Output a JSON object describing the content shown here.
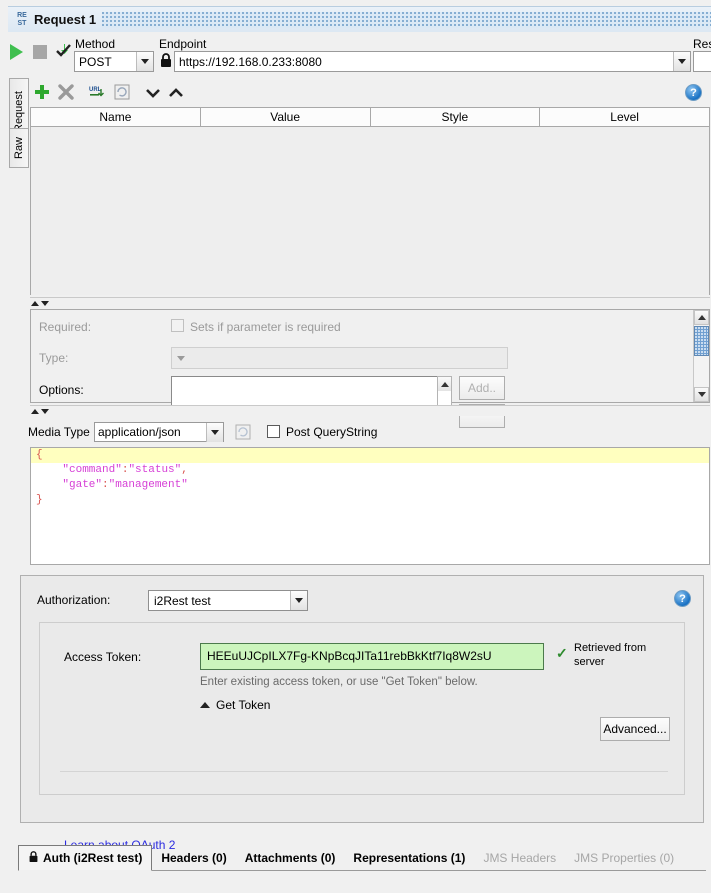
{
  "window": {
    "badge_line1": "RE",
    "badge_line2": "ST",
    "title": "Request 1"
  },
  "toolbar": {
    "method_label": "Method",
    "method_value": "POST",
    "endpoint_label": "Endpoint",
    "endpoint_value": "https://192.168.0.233:8080",
    "resource_label": "Res",
    "run_icon": "play-icon",
    "stop_icon": "stop-icon",
    "submit_icon": "submit-check-icon",
    "lock_icon": "lock-icon"
  },
  "side_tabs": [
    {
      "label": "Request",
      "active": true
    },
    {
      "label": "Raw",
      "active": false
    }
  ],
  "params_toolbar": {
    "add_icon": "plus-icon",
    "remove_icon": "x-icon",
    "url_icon": "url-icon",
    "refresh_icon": "refresh-icon",
    "move_down_icon": "chevron-down-icon",
    "move_up_icon": "chevron-up-icon",
    "help_icon": "help-icon",
    "help_glyph": "?"
  },
  "params_table": {
    "columns": [
      "Name",
      "Value",
      "Style",
      "Level"
    ],
    "rows": []
  },
  "detail": {
    "required_label": "Required:",
    "required_checkbox_label": "Sets if parameter is required",
    "required_checked": false,
    "type_label": "Type:",
    "type_value": "",
    "options_label": "Options:",
    "options_value": "",
    "add_button": "Add..",
    "add_button2": ""
  },
  "media": {
    "label": "Media Type",
    "value": "application/json",
    "format_icon": "format-icon",
    "post_querystring_label": "Post QueryString",
    "post_querystring_checked": false
  },
  "body": {
    "lines": [
      {
        "text": "{",
        "kind": "brace",
        "highlight": true
      },
      {
        "text": "    \"command\":\"status\",",
        "kind": "string",
        "highlight": false
      },
      {
        "text": "    \"gate\":\"management\"",
        "kind": "string",
        "highlight": false
      },
      {
        "text": "}",
        "kind": "brace",
        "highlight": false
      }
    ],
    "line1": "{",
    "line2_key": "\"command\"",
    "line2_sep": ":",
    "line2_val": "\"status\"",
    "line2_comma": ",",
    "line3_key": "\"gate\"",
    "line3_sep": ":",
    "line3_val": "\"management\"",
    "line4": "}"
  },
  "authorization": {
    "label": "Authorization:",
    "value": "i2Rest test",
    "help_glyph": "?",
    "access_token_label": "Access Token:",
    "access_token_value": "HEEuUJCpILX7Fg-KNpBcqJITa11rebBkKtf7Iq8W2sU",
    "status_check": "✓",
    "status_text": "Retrieved from server",
    "hint": "Enter existing access token, or use \"Get Token\" below.",
    "get_token_label": "Get Token",
    "advanced_button": "Advanced...",
    "learn_link": "Learn about OAuth 2"
  },
  "bottom_tabs": [
    {
      "label": "Auth (i2Rest test)",
      "active": true,
      "dim": false,
      "icon": "lock-icon"
    },
    {
      "label": "Headers (0)",
      "active": false,
      "dim": false,
      "icon": ""
    },
    {
      "label": "Attachments (0)",
      "active": false,
      "dim": false,
      "icon": ""
    },
    {
      "label": "Representations (1)",
      "active": false,
      "dim": false,
      "icon": ""
    },
    {
      "label": "JMS Headers",
      "active": false,
      "dim": true,
      "icon": ""
    },
    {
      "label": "JMS Properties (0)",
      "active": false,
      "dim": true,
      "icon": ""
    }
  ],
  "colors": {
    "accent_blue": "#1a72c4",
    "token_green_bg": "#ccf5bd",
    "json_string": "#d63fd6",
    "json_brace": "#d9534f",
    "link_blue": "#2b2be0",
    "highlight_yellow": "#ffffbf"
  }
}
